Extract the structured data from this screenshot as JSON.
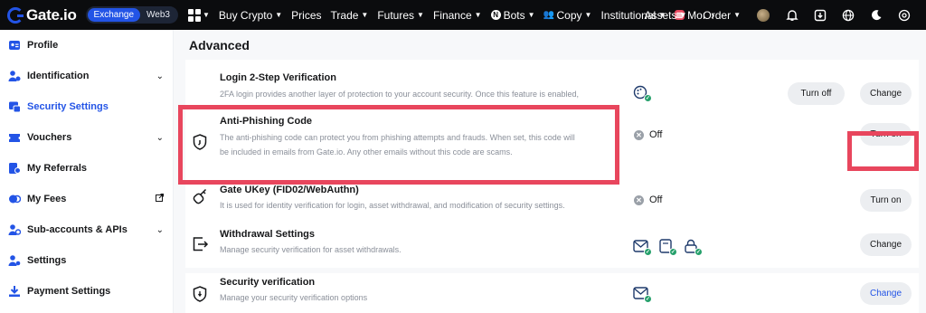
{
  "topbar": {
    "logo_text": "Gate.io",
    "mode_tabs": [
      "Exchange",
      "Web3"
    ],
    "nav_items": [
      {
        "label": "Buy Crypto",
        "caret": true
      },
      {
        "label": "Prices",
        "caret": false
      },
      {
        "label": "Trade",
        "caret": true
      },
      {
        "label": "Futures",
        "caret": true
      },
      {
        "label": "Finance",
        "caret": true
      },
      {
        "label": "Bots",
        "caret": true
      },
      {
        "label": "Copy",
        "caret": true
      },
      {
        "label": "Institutional",
        "caret": true
      },
      {
        "label": "Moı",
        "caret": false
      }
    ],
    "more_glyph": "›",
    "right_items": [
      {
        "label": "Assets"
      },
      {
        "label": "Order"
      }
    ]
  },
  "sidebar": {
    "items": [
      {
        "label": "Profile",
        "icon": "profile-icon",
        "right": ""
      },
      {
        "label": "Identification",
        "icon": "id-icon",
        "right": "chevron"
      },
      {
        "label": "Security Settings",
        "icon": "security-icon",
        "right": ""
      },
      {
        "label": "Vouchers",
        "icon": "voucher-icon",
        "right": "chevron"
      },
      {
        "label": "My Referrals",
        "icon": "referrals-icon",
        "right": ""
      },
      {
        "label": "My Fees",
        "icon": "fees-icon",
        "right": "external"
      },
      {
        "label": "Sub-accounts & APIs",
        "icon": "subaccounts-icon",
        "right": "chevron"
      },
      {
        "label": "Settings",
        "icon": "settings-icon",
        "right": ""
      },
      {
        "label": "Payment Settings",
        "icon": "payment-icon",
        "right": ""
      }
    ],
    "active_index": 2
  },
  "main": {
    "section_title": "Advanced",
    "rows": [
      {
        "title": "Login 2-Step Verification",
        "desc": [
          "2FA login provides another layer of protection to your account security. Once this feature is enabled,"
        ],
        "status_type": "icons",
        "buttons": [
          "Turn off",
          "Change"
        ]
      },
      {
        "title": "Anti-Phishing Code",
        "desc": [
          "The anti-phishing code can protect you from phishing attempts and frauds. When set, this code will",
          "be included in emails from Gate.io. Any other emails without this code are scams."
        ],
        "status_type": "off",
        "status_text": "Off",
        "buttons": [
          "Turn on"
        ]
      },
      {
        "title": "Gate UKey (FID02/WebAuthn)",
        "desc": [
          "It is used for identity verification for login, asset withdrawal, and modification of security settings."
        ],
        "status_type": "off",
        "status_text": "Off",
        "buttons": [
          "Turn on"
        ]
      },
      {
        "title": "Withdrawal Settings",
        "desc": [
          "Manage security verification for asset withdrawals."
        ],
        "status_type": "icons",
        "buttons": [
          "Change"
        ]
      },
      {
        "title": "Security verification",
        "desc": [
          "Manage your security verification options"
        ],
        "status_type": "icons",
        "buttons": [
          "Change"
        ]
      }
    ]
  },
  "colors": {
    "accent": "#2354e6",
    "highlight": "#e8465d",
    "success": "#26a06b",
    "topbar": "#0b0c0e"
  }
}
